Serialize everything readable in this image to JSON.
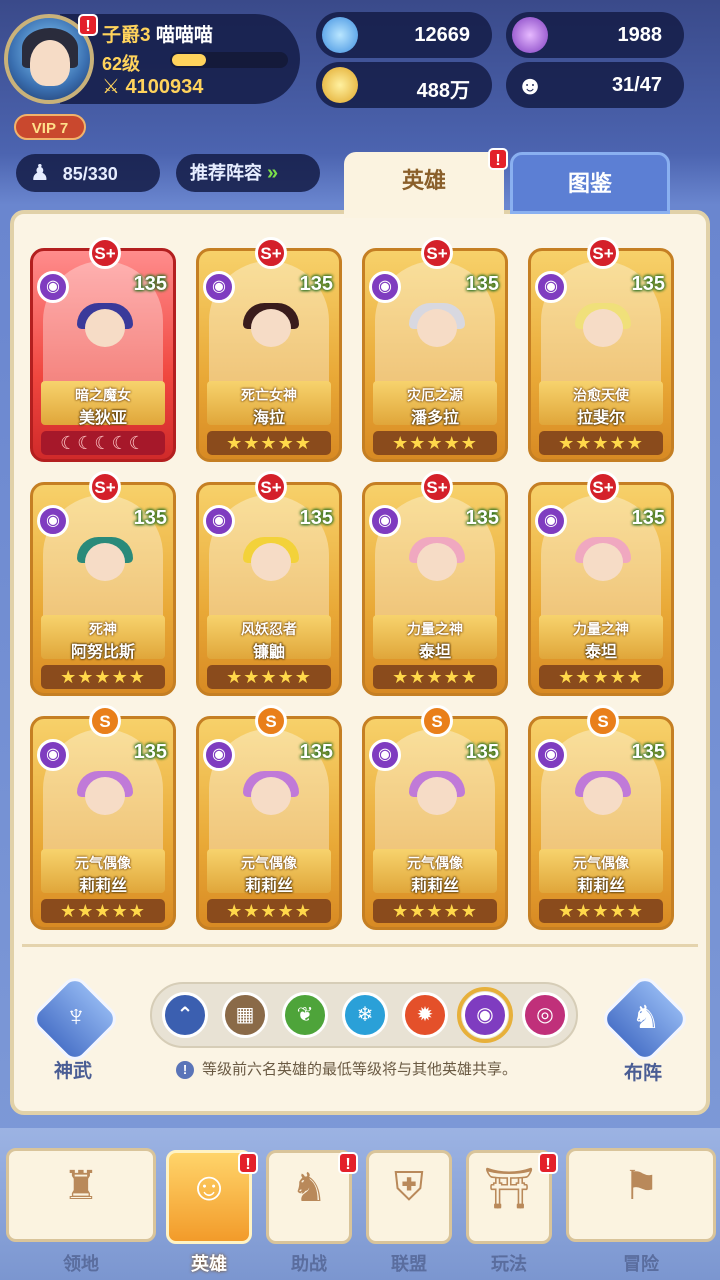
{
  "player": {
    "rank": "子爵3",
    "name": "喵喵喵",
    "level": "62级",
    "power": "4100934",
    "vip": "VIP 7",
    "xp_fraction": 0.3
  },
  "resources": [
    {
      "icon": "star-gem-icon",
      "value": "12669"
    },
    {
      "icon": "purple-crystal-icon",
      "value": "1988"
    },
    {
      "icon": "gold-coin-icon",
      "value": "488万"
    },
    {
      "icon": "friends-icon",
      "value": "31/47"
    }
  ],
  "hero_count": "85/330",
  "recommend_label": "推荐阵容",
  "tabs": {
    "heroes": "英雄",
    "codex": "图鉴"
  },
  "alert_mark": "!",
  "heroes": [
    {
      "grade": "S+",
      "level": "135",
      "title": "暗之魔女",
      "name": "美狄亚",
      "stars": "☾☾☾☾☾",
      "frame": "red",
      "hair": "#3a3a9a"
    },
    {
      "grade": "S+",
      "level": "135",
      "title": "死亡女神",
      "name": "海拉",
      "stars": "★★★★★",
      "frame": "gold",
      "hair": "#3a1c1c"
    },
    {
      "grade": "S+",
      "level": "135",
      "title": "灾厄之源",
      "name": "潘多拉",
      "stars": "★★★★★",
      "frame": "gold",
      "hair": "#d8d8e0"
    },
    {
      "grade": "S+",
      "level": "135",
      "title": "治愈天使",
      "name": "拉斐尔",
      "stars": "★★★★★",
      "frame": "gold",
      "hair": "#f0e07a"
    },
    {
      "grade": "S+",
      "level": "135",
      "title": "死神",
      "name": "阿努比斯",
      "stars": "★★★★★",
      "frame": "gold",
      "hair": "#2a8a7a"
    },
    {
      "grade": "S+",
      "level": "135",
      "title": "风妖忍者",
      "name": "镰鼬",
      "stars": "★★★★★",
      "frame": "gold",
      "hair": "#f3d23a"
    },
    {
      "grade": "S+",
      "level": "135",
      "title": "力量之神",
      "name": "泰坦",
      "stars": "★★★★★",
      "frame": "gold",
      "hair": "#f0a8c0"
    },
    {
      "grade": "S+",
      "level": "135",
      "title": "力量之神",
      "name": "泰坦",
      "stars": "★★★★★",
      "frame": "gold",
      "hair": "#f0a8c0"
    },
    {
      "grade": "S",
      "level": "135",
      "title": "元气偶像",
      "name": "莉莉丝",
      "stars": "★★★★★",
      "frame": "gold",
      "hair": "#c07ad8"
    },
    {
      "grade": "S",
      "level": "135",
      "title": "元气偶像",
      "name": "莉莉丝",
      "stars": "★★★★★",
      "frame": "gold",
      "hair": "#c07ad8"
    },
    {
      "grade": "S",
      "level": "135",
      "title": "元气偶像",
      "name": "莉莉丝",
      "stars": "★★★★★",
      "frame": "gold",
      "hair": "#c07ad8"
    },
    {
      "grade": "S",
      "level": "135",
      "title": "元气偶像",
      "name": "莉莉丝",
      "stars": "★★★★★",
      "frame": "gold",
      "hair": "#c07ad8"
    }
  ],
  "element_mark": "◉",
  "side_buttons": {
    "weapon": "神武",
    "formation": "布阵"
  },
  "filters": [
    {
      "name": "rank-up-filter-icon",
      "color": "#3b5fb0",
      "glyph": "⌃"
    },
    {
      "name": "all-filter-icon",
      "color": "#8a6a48",
      "glyph": "▦"
    },
    {
      "name": "nature-filter-icon",
      "color": "#4ea43a",
      "glyph": "❦"
    },
    {
      "name": "ice-filter-icon",
      "color": "#2aa0d8",
      "glyph": "❄"
    },
    {
      "name": "fire-filter-icon",
      "color": "#e4502a",
      "glyph": "✹"
    },
    {
      "name": "dark-eye-filter-icon",
      "color": "#7f3cc0",
      "glyph": "◉"
    },
    {
      "name": "chaos-filter-icon",
      "color": "#c0307a",
      "glyph": "◎"
    }
  ],
  "note": "等级前六名英雄的最低等级将与其他英雄共享。",
  "info_mark": "!",
  "nav": [
    {
      "label": "领地",
      "glyph": "♜"
    },
    {
      "label": "英雄",
      "glyph": "☺"
    },
    {
      "label": "助战",
      "glyph": "♞"
    },
    {
      "label": "联盟",
      "glyph": "⛨"
    },
    {
      "label": "玩法",
      "glyph": "⛩"
    },
    {
      "label": "冒险",
      "glyph": "⚑"
    }
  ]
}
